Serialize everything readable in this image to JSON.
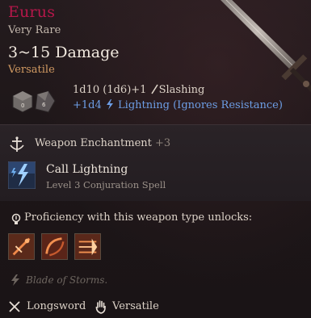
{
  "item": {
    "name": "Eurus",
    "rarity": "Very Rare",
    "damage": "3~15 Damage",
    "property": "Versatile"
  },
  "damage_rows": [
    {
      "text": "1d10 (1d6)+1",
      "type": "Slashing"
    },
    {
      "text": "+1d4",
      "type": "Lightning (Ignores Resistance)"
    }
  ],
  "enchantment": {
    "title": "Weapon Enchantment",
    "bonus": "+3"
  },
  "spell": {
    "name": "Call Lightning",
    "subtitle": "Level 3 Conjuration Spell"
  },
  "proficiency": {
    "text": "Proficiency with this weapon type unlocks:"
  },
  "flavor": "Blade of Storms.",
  "footer": {
    "weapon_type": "Longsword",
    "property": "Versatile"
  },
  "colors": {
    "name": "#b5174a",
    "property": "#d19a62",
    "lightning": "#6d9ee6"
  },
  "icons": [
    "longsword-image",
    "dice-icon",
    "slash-icon",
    "lightning-bolt-icon",
    "enchantment-icon",
    "call-lightning-icon",
    "proficiency-icon",
    "action-icon",
    "storm-icon",
    "crossed-swords-icon",
    "hand-icon"
  ]
}
